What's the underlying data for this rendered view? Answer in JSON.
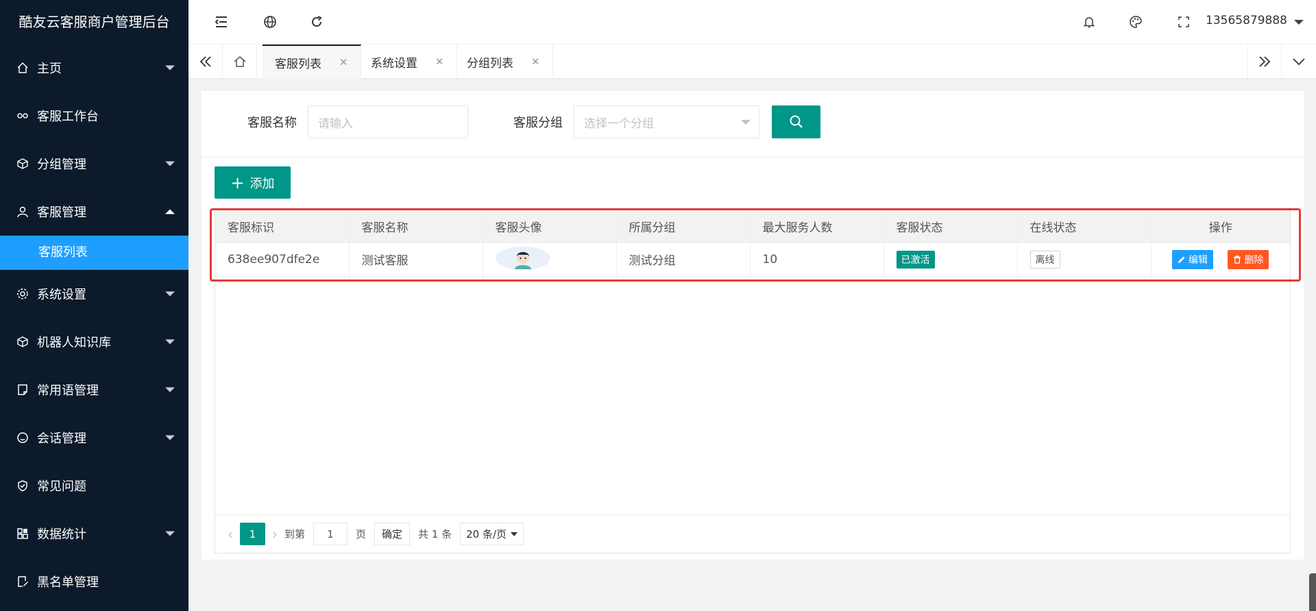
{
  "app": {
    "title": "酷友云客服商户管理后台"
  },
  "sidebar": {
    "items": [
      {
        "label": "主页",
        "icon": "home-icon",
        "arrow": "down"
      },
      {
        "label": "客服工作台",
        "icon": "link-icon",
        "arrow": ""
      },
      {
        "label": "分组管理",
        "icon": "cube-icon",
        "arrow": "down"
      },
      {
        "label": "客服管理",
        "icon": "user-icon",
        "arrow": "up"
      },
      {
        "label": "系统设置",
        "icon": "gear-icon",
        "arrow": "down"
      },
      {
        "label": "机器人知识库",
        "icon": "cube-icon",
        "arrow": "down"
      },
      {
        "label": "常用语管理",
        "icon": "note-icon",
        "arrow": "down"
      },
      {
        "label": "会话管理",
        "icon": "smile-icon",
        "arrow": "down"
      },
      {
        "label": "常见问题",
        "icon": "shield-icon",
        "arrow": ""
      },
      {
        "label": "数据统计",
        "icon": "grid-icon",
        "arrow": "down"
      },
      {
        "label": "黑名单管理",
        "icon": "edit-icon",
        "arrow": ""
      }
    ],
    "submenu": {
      "label": "客服列表"
    }
  },
  "header": {
    "user": "13565879888"
  },
  "tabs": [
    {
      "label": "客服列表",
      "active": true
    },
    {
      "label": "系统设置",
      "active": false
    },
    {
      "label": "分组列表",
      "active": false
    }
  ],
  "search": {
    "name_label": "客服名称",
    "name_placeholder": "请输入",
    "group_label": "客服分组",
    "group_placeholder": "选择一个分组"
  },
  "toolbar": {
    "add_label": "添加"
  },
  "table": {
    "columns": [
      "客服标识",
      "客服名称",
      "客服头像",
      "所属分组",
      "最大服务人数",
      "客服状态",
      "在线状态",
      "操作"
    ],
    "rows": [
      {
        "id": "638ee907dfe2e",
        "name": "测试客服",
        "group": "测试分组",
        "max": "10",
        "status": "已激活",
        "online": "离线",
        "edit": "编辑",
        "delete": "删除"
      }
    ]
  },
  "pager": {
    "current": "1",
    "goto_label": "到第",
    "goto_value": "1",
    "page_unit": "页",
    "confirm": "确定",
    "total": "共 1 条",
    "page_size": "20 条/页"
  },
  "colors": {
    "primary": "#009688",
    "sidebar": "#0c1a2b",
    "blue": "#1e9fff",
    "danger": "#ff5722",
    "highlight": "#e53935"
  }
}
